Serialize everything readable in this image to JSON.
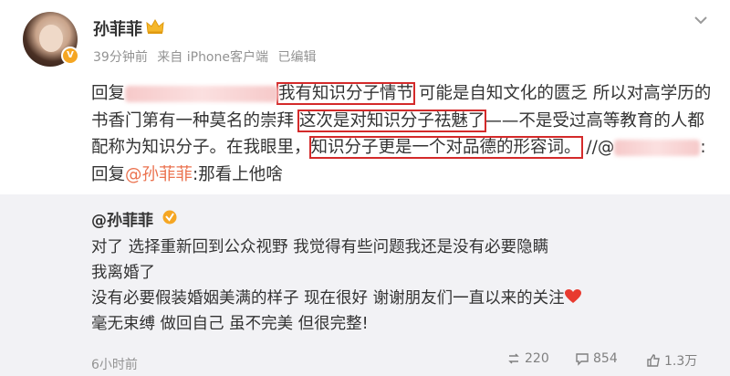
{
  "header": {
    "username": "孙菲菲",
    "meta": {
      "time": "39分钟前",
      "source": "来自 iPhone客户端",
      "edited": "已编辑"
    }
  },
  "post": {
    "reply_prefix": "回复",
    "text1_hl": "我有知识分子情节",
    "text2": "可能是自知文化的匮乏 所以对高学历的书香门第有一种莫名的崇拜",
    "text3_hl": "这次是对知识分子祛魅了",
    "text4": "——不是受过高等教育的人都配称为知识分子。在我眼里，",
    "text5_hl": "知识分子更是一个对品德的形容词。",
    "text6": "//@",
    "text7": ":回复",
    "mention": "@孙菲菲",
    "text8": ":那看上他啥"
  },
  "repost": {
    "username": "@孙菲菲",
    "lines": [
      "对了 选择重新回到公众视野 我觉得有些问题我还是没有必要隐瞒",
      "我离婚了",
      "没有必要假装婚姻美满的样子 现在很好 谢谢朋友们一直以来的关注",
      "毫无束缚 做回自己 虽不完美 但很完整!"
    ],
    "time": "6小时前",
    "reposts": "220",
    "comments": "854",
    "likes": "1.3万"
  }
}
